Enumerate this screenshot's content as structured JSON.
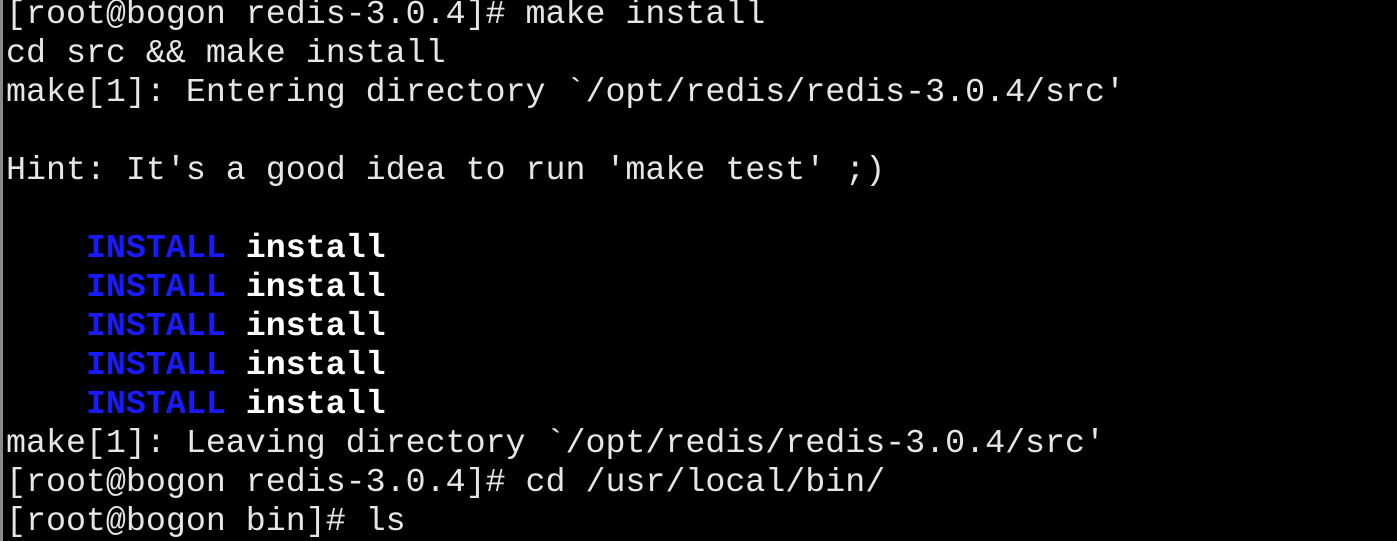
{
  "terminal": {
    "lines": [
      "[root@bogon redis-3.0.4]# make install",
      "cd src && make install",
      "make[1]: Entering directory `/opt/redis/redis-3.0.4/src'",
      "",
      "Hint: It's a good idea to run 'make test' ;)",
      "",
      "make[1]: Leaving directory `/opt/redis/redis-3.0.4/src'",
      "[root@bogon redis-3.0.4]# cd /usr/local/bin/",
      "[root@bogon bin]# ls"
    ],
    "install_rows": [
      {
        "indent": "    ",
        "tag": "INSTALL",
        "target": "install"
      },
      {
        "indent": "    ",
        "tag": "INSTALL",
        "target": "install"
      },
      {
        "indent": "    ",
        "tag": "INSTALL",
        "target": "install"
      },
      {
        "indent": "    ",
        "tag": "INSTALL",
        "target": "install"
      },
      {
        "indent": "    ",
        "tag": "INSTALL",
        "target": "install"
      }
    ],
    "colors": {
      "background": "#000000",
      "text": "#e6e6e6",
      "install_tag": "#1a1aff",
      "install_target": "#ffffff"
    }
  }
}
